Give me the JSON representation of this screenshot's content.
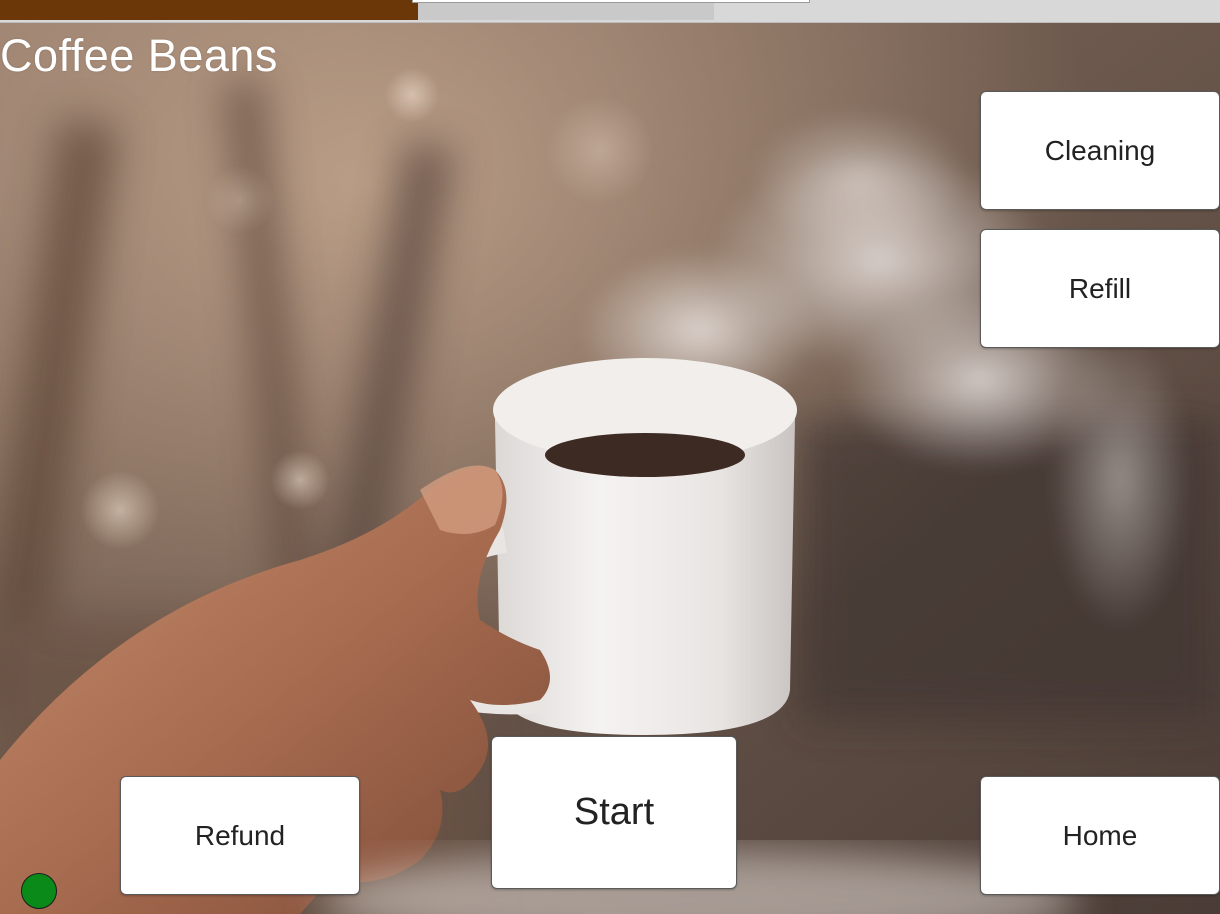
{
  "app": {
    "title": "Coffee Beans"
  },
  "progress": {
    "percent": 58.5,
    "fill_color": "#6b3608"
  },
  "buttons": {
    "cleaning": "Cleaning",
    "refill": "Refill",
    "refund": "Refund",
    "start": "Start",
    "home": "Home"
  },
  "status": {
    "color": "#0a8a18"
  },
  "background": {
    "subject": "hand-holding-steaming-coffee-cup"
  }
}
